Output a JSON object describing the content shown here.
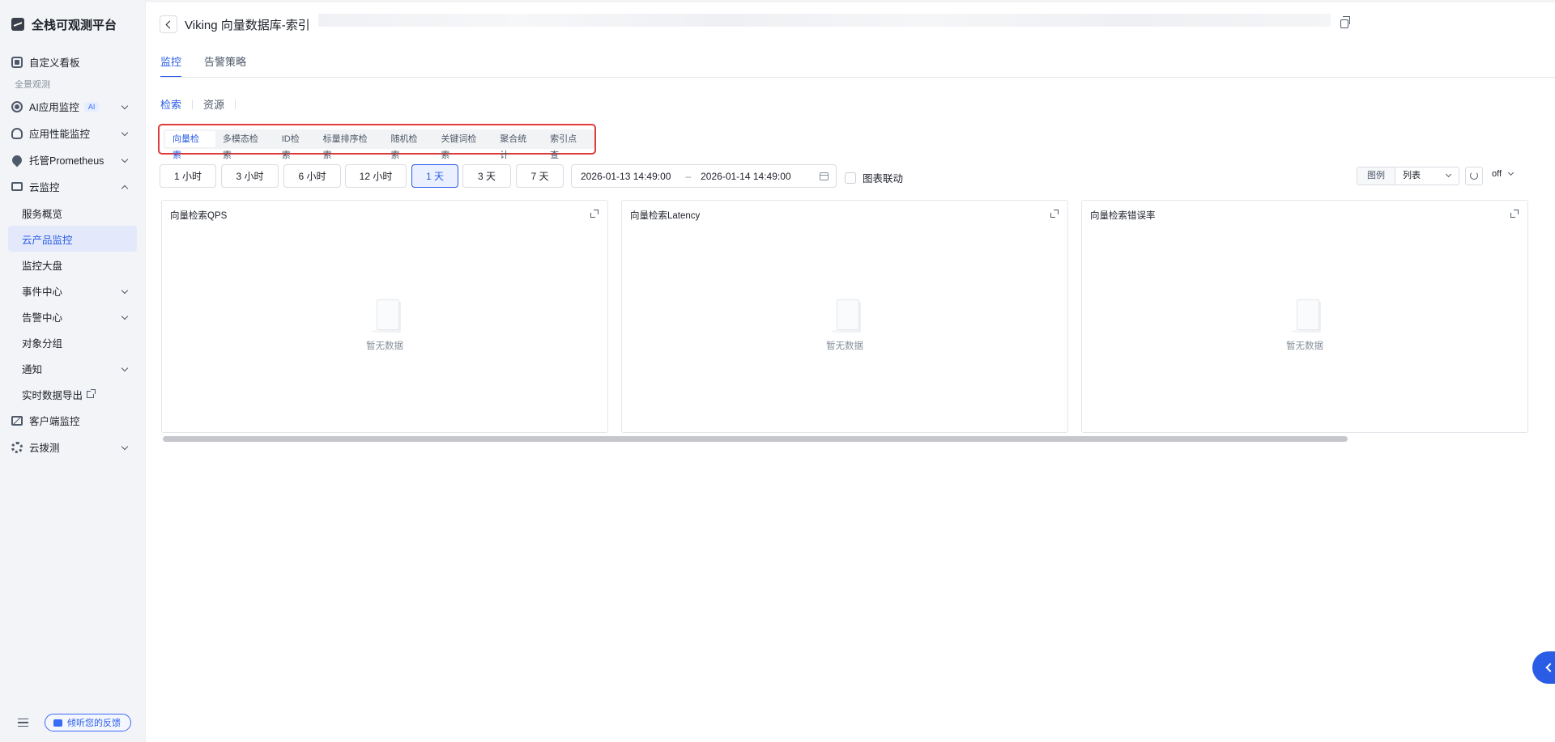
{
  "app": {
    "name": "全栈可观测平台"
  },
  "sidebar": {
    "items": [
      {
        "label": "自定义看板"
      },
      {
        "group": "全景观测"
      },
      {
        "label": "AI应用监控",
        "badge": "AI"
      },
      {
        "label": "应用性能监控"
      },
      {
        "label": "托管Prometheus"
      },
      {
        "label": "云监控"
      }
    ],
    "cloud_sub": [
      {
        "label": "服务概览"
      },
      {
        "label": "云产品监控"
      },
      {
        "label": "监控大盘"
      },
      {
        "label": "事件中心"
      },
      {
        "label": "告警中心"
      },
      {
        "label": "对象分组"
      },
      {
        "label": "通知"
      },
      {
        "label": "实时数据导出"
      }
    ],
    "bottom_items": [
      {
        "label": "客户端监控"
      },
      {
        "label": "云拨测"
      }
    ],
    "feedback_label": "倾听您的反馈"
  },
  "header": {
    "title": "Viking 向量数据库-索引"
  },
  "tabs": [
    {
      "label": "监控"
    },
    {
      "label": "告警策略"
    }
  ],
  "subtabs": [
    {
      "label": "检索"
    },
    {
      "label": "资源"
    }
  ],
  "segments": [
    {
      "label": "向量检索"
    },
    {
      "label": "多模态检索"
    },
    {
      "label": "ID检索"
    },
    {
      "label": "标量排序检索"
    },
    {
      "label": "随机检索"
    },
    {
      "label": "关键词检索"
    },
    {
      "label": "聚合统计"
    },
    {
      "label": "索引点查"
    }
  ],
  "time_ranges": [
    {
      "label": "1 小时"
    },
    {
      "label": "3 小时"
    },
    {
      "label": "6 小时"
    },
    {
      "label": "12 小时"
    },
    {
      "label": "1 天"
    },
    {
      "label": "3 天"
    },
    {
      "label": "7 天"
    }
  ],
  "date_range": {
    "start": "2026-01-13 14:49:00",
    "separator": "–",
    "end": "2026-01-14 14:49:00"
  },
  "chart_link_label": "图表联动",
  "legend": {
    "label": "图例",
    "value": "列表"
  },
  "auto_refresh": {
    "value": "off"
  },
  "panels": [
    {
      "title": "向量检索QPS",
      "empty_text": "暂无数据"
    },
    {
      "title": "向量检索Latency",
      "empty_text": "暂无数据"
    },
    {
      "title": "向量检索错误率",
      "empty_text": "暂无数据"
    }
  ],
  "colors": {
    "accent": "#2a5ce6",
    "highlight_border": "#e03b3b",
    "sidebar_bg": "#f3f4f7"
  }
}
